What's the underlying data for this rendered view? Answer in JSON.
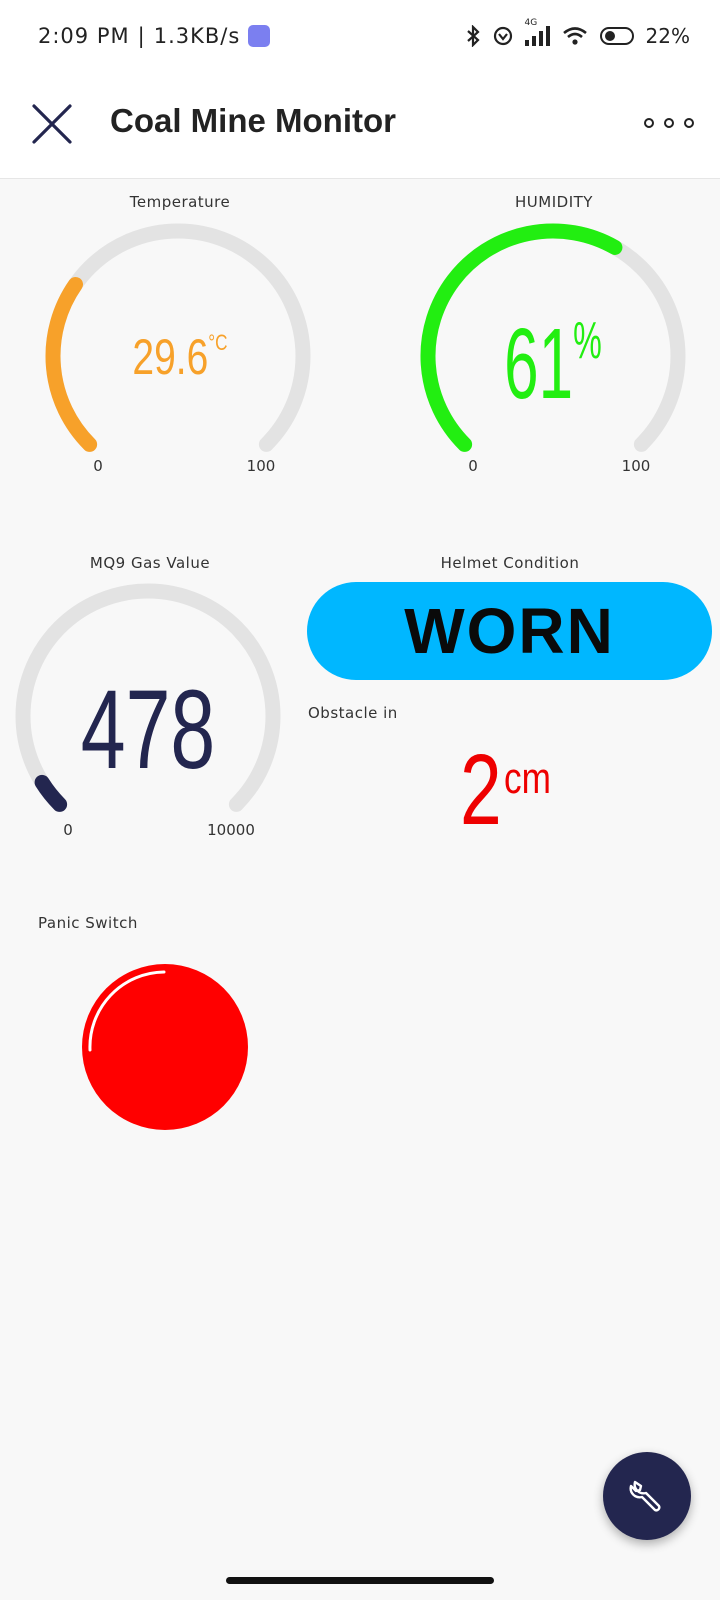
{
  "status_bar": {
    "time": "2:09 PM",
    "net_speed": "1.3KB/s",
    "network_type": "4G",
    "battery": "22%",
    "icons": [
      "bluetooth-icon",
      "vpn-icon",
      "signal-icon",
      "wifi-icon",
      "battery-icon"
    ]
  },
  "header": {
    "title": "Coal Mine Monitor",
    "close_icon": "close-icon",
    "more_icon": "more-options-icon"
  },
  "widgets": {
    "temperature": {
      "label": "Temperature",
      "value": "29.6",
      "unit": "°C",
      "numeric": 29.6,
      "min": "0",
      "max": "100",
      "color": "#f7a12a"
    },
    "humidity": {
      "label": "HUMIDITY",
      "value": "61",
      "unit": "%",
      "numeric": 61,
      "min": "0",
      "max": "100",
      "color": "#22ee11"
    },
    "gas": {
      "label": "MQ9 Gas Value",
      "value": "478",
      "numeric": 478,
      "min": "0",
      "max": "10000",
      "color": "#23264f"
    },
    "helmet": {
      "label": "Helmet Condition",
      "value": "WORN",
      "color": "#00b7ff"
    },
    "obstacle": {
      "label": "Obstacle in",
      "value": "2",
      "unit": "cm",
      "color": "#ee0000"
    },
    "panic": {
      "label": "Panic Switch",
      "color": "#ff0000"
    }
  },
  "fab": {
    "icon": "wrench-icon",
    "color": "#23264f"
  },
  "colors": {
    "track": "#e3e3e3",
    "background": "#f8f8f8"
  }
}
